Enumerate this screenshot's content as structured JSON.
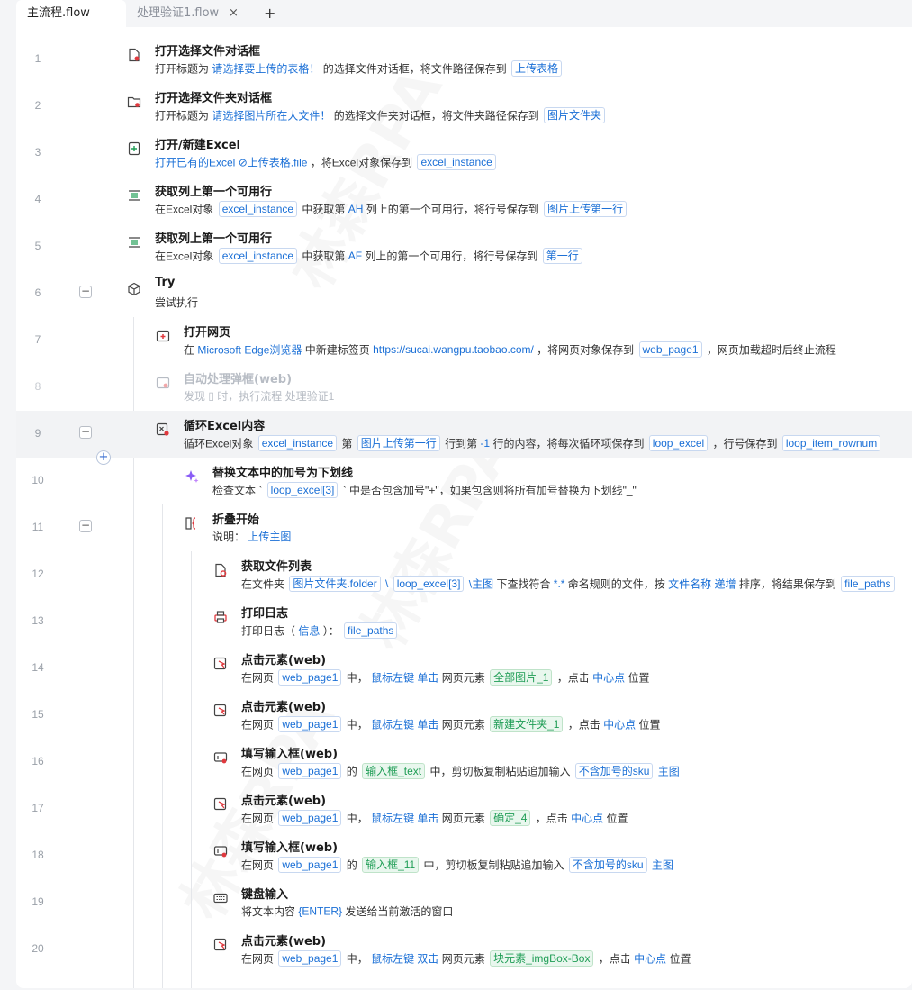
{
  "tabs": [
    {
      "label": "主流程.flow",
      "active": true
    },
    {
      "label": "处理验证1.flow",
      "active": false
    }
  ],
  "tab_close": "×",
  "tab_add": "+",
  "watermark": "林森RPA",
  "rows": [
    {
      "num": "1",
      "title": "打开选择文件对话框",
      "parts": [
        {
          "t": "打开标题为 "
        },
        {
          "t": "请选择要上传的表格！",
          "k": "lnk"
        },
        {
          "t": " 的选择文件对话框，将文件路径保存到 "
        },
        {
          "t": "上传表格",
          "k": "chip"
        }
      ]
    },
    {
      "num": "2",
      "title": "打开选择文件夹对话框",
      "parts": [
        {
          "t": "打开标题为 "
        },
        {
          "t": "请选择图片所在大文件！",
          "k": "lnk"
        },
        {
          "t": " 的选择文件夹对话框，将文件夹路径保存到 "
        },
        {
          "t": "图片文件夹",
          "k": "chip"
        }
      ]
    },
    {
      "num": "3",
      "title": "打开/新建Excel",
      "parts": [
        {
          "t": "打开已有的Excel ",
          "k": "lnk"
        },
        {
          "t": "⊘上传表格.file",
          "k": "lnk"
        },
        {
          "t": " ，将Excel对象保存到 "
        },
        {
          "t": "excel_instance",
          "k": "chip"
        }
      ]
    },
    {
      "num": "4",
      "title": "获取列上第一个可用行",
      "parts": [
        {
          "t": "在Excel对象 "
        },
        {
          "t": "excel_instance",
          "k": "chip"
        },
        {
          "t": " 中获取第 "
        },
        {
          "t": "AH",
          "k": "lnk"
        },
        {
          "t": " 列上的第一个可用行，将行号保存到 "
        },
        {
          "t": "图片上传第一行",
          "k": "chip"
        }
      ]
    },
    {
      "num": "5",
      "title": "获取列上第一个可用行",
      "parts": [
        {
          "t": "在Excel对象 "
        },
        {
          "t": "excel_instance",
          "k": "chip"
        },
        {
          "t": " 中获取第 "
        },
        {
          "t": "AF",
          "k": "lnk"
        },
        {
          "t": " 列上的第一个可用行，将行号保存到 "
        },
        {
          "t": "第一行",
          "k": "chip"
        }
      ]
    },
    {
      "num": "6",
      "title": "Try",
      "parts": [
        {
          "t": "尝试执行"
        }
      ]
    },
    {
      "num": "7",
      "title": "打开网页",
      "parts": [
        {
          "t": "在 "
        },
        {
          "t": "Microsoft Edge浏览器",
          "k": "lnk"
        },
        {
          "t": " 中新建标签页 "
        },
        {
          "t": "https://sucai.wangpu.taobao.com/",
          "k": "lnk"
        },
        {
          "t": " ，将网页对象保存到 "
        },
        {
          "t": "web_page1",
          "k": "chip"
        },
        {
          "t": " ，网页加载超时后终止流程"
        }
      ]
    },
    {
      "num": "8",
      "title": "自动处理弹框(web)",
      "parts": [
        {
          "t": "发现 "
        },
        {
          "t": "▯",
          "k": "lnk"
        },
        {
          "t": " 时，执行流程 "
        },
        {
          "t": "处理验证1",
          "k": "lnk"
        }
      ]
    },
    {
      "num": "9",
      "title": "循环Excel内容",
      "parts": [
        {
          "t": "循环Excel对象 "
        },
        {
          "t": "excel_instance",
          "k": "chip"
        },
        {
          "t": " 第 "
        },
        {
          "t": "图片上传第一行",
          "k": "chip"
        },
        {
          "t": " 行到第 "
        },
        {
          "t": "-1",
          "k": "lnk"
        },
        {
          "t": " 行的内容，将每次循环项保存到 "
        },
        {
          "t": "loop_excel",
          "k": "chip"
        },
        {
          "t": " ，行号保存到 "
        },
        {
          "t": "loop_item_rownum",
          "k": "chip"
        }
      ]
    },
    {
      "num": "10",
      "title": "替换文本中的加号为下划线",
      "parts": [
        {
          "t": "检查文本 ` "
        },
        {
          "t": "loop_excel[3]",
          "k": "chip"
        },
        {
          "t": " ` 中是否包含加号\"+\"，如果包含则将所有加号替换为下划线\"_\""
        }
      ]
    },
    {
      "num": "11",
      "title": "折叠开始",
      "parts": [
        {
          "t": "说明： "
        },
        {
          "t": "上传主图",
          "k": "lnk"
        }
      ]
    },
    {
      "num": "12",
      "title": "获取文件列表",
      "parts": [
        {
          "t": "在文件夹 "
        },
        {
          "t": "图片文件夹.folder",
          "k": "chip"
        },
        {
          "t": " \\ ",
          "k": "lnk"
        },
        {
          "t": "loop_excel[3]",
          "k": "chip"
        },
        {
          "t": " \\主图",
          "k": "lnk"
        },
        {
          "t": " 下查找符合 "
        },
        {
          "t": "*.*",
          "k": "lnk"
        },
        {
          "t": " 命名规则的文件，按 "
        },
        {
          "t": "文件名称 递增",
          "k": "lnk"
        },
        {
          "t": " 排序，将结果保存到 "
        },
        {
          "t": "file_paths",
          "k": "chip"
        }
      ]
    },
    {
      "num": "13",
      "title": "打印日志",
      "parts": [
        {
          "t": "打印日志（ "
        },
        {
          "t": "信息",
          "k": "lnk"
        },
        {
          "t": " ）： "
        },
        {
          "t": "file_paths",
          "k": "chip"
        }
      ]
    },
    {
      "num": "14",
      "title": "点击元素(web)",
      "parts": [
        {
          "t": "在网页 "
        },
        {
          "t": "web_page1",
          "k": "chip"
        },
        {
          "t": " 中， "
        },
        {
          "t": "鼠标左键 单击",
          "k": "lnk"
        },
        {
          "t": " 网页元素 "
        },
        {
          "t": "全部图片_1",
          "k": "green"
        },
        {
          "t": " ，点击 "
        },
        {
          "t": "中心点",
          "k": "lnk"
        },
        {
          "t": " 位置"
        }
      ]
    },
    {
      "num": "15",
      "title": "点击元素(web)",
      "parts": [
        {
          "t": "在网页 "
        },
        {
          "t": "web_page1",
          "k": "chip"
        },
        {
          "t": " 中， "
        },
        {
          "t": "鼠标左键 单击",
          "k": "lnk"
        },
        {
          "t": " 网页元素 "
        },
        {
          "t": "新建文件夹_1",
          "k": "green"
        },
        {
          "t": " ，点击 "
        },
        {
          "t": "中心点",
          "k": "lnk"
        },
        {
          "t": " 位置"
        }
      ]
    },
    {
      "num": "16",
      "title": "填写输入框(web)",
      "parts": [
        {
          "t": "在网页 "
        },
        {
          "t": "web_page1",
          "k": "chip"
        },
        {
          "t": " 的 "
        },
        {
          "t": "输入框_text",
          "k": "green"
        },
        {
          "t": " 中，剪切板复制粘贴追加输入 "
        },
        {
          "t": "不含加号的sku",
          "k": "chip"
        },
        {
          "t": " 主图",
          "k": "lnk"
        }
      ]
    },
    {
      "num": "17",
      "title": "点击元素(web)",
      "parts": [
        {
          "t": "在网页 "
        },
        {
          "t": "web_page1",
          "k": "chip"
        },
        {
          "t": " 中， "
        },
        {
          "t": "鼠标左键 单击",
          "k": "lnk"
        },
        {
          "t": " 网页元素 "
        },
        {
          "t": "确定_4",
          "k": "green"
        },
        {
          "t": " ，点击 "
        },
        {
          "t": "中心点",
          "k": "lnk"
        },
        {
          "t": " 位置"
        }
      ]
    },
    {
      "num": "18",
      "title": "填写输入框(web)",
      "parts": [
        {
          "t": "在网页 "
        },
        {
          "t": "web_page1",
          "k": "chip"
        },
        {
          "t": " 的 "
        },
        {
          "t": "输入框_11",
          "k": "green"
        },
        {
          "t": " 中，剪切板复制粘贴追加输入 "
        },
        {
          "t": "不含加号的sku",
          "k": "chip"
        },
        {
          "t": " 主图",
          "k": "lnk"
        }
      ]
    },
    {
      "num": "19",
      "title": "键盘输入",
      "parts": [
        {
          "t": "将文本内容 "
        },
        {
          "t": "{ENTER}",
          "k": "lnk"
        },
        {
          "t": " 发送给当前激活的窗口"
        }
      ]
    },
    {
      "num": "20",
      "title": "点击元素(web)",
      "parts": [
        {
          "t": "在网页 "
        },
        {
          "t": "web_page1",
          "k": "chip"
        },
        {
          "t": " 中， "
        },
        {
          "t": "鼠标左键 双击",
          "k": "lnk"
        },
        {
          "t": " 网页元素 "
        },
        {
          "t": "块元素_imgBox-Box",
          "k": "green"
        },
        {
          "t": " ，点击 "
        },
        {
          "t": "中心点",
          "k": "lnk"
        },
        {
          "t": " 位置"
        }
      ]
    }
  ],
  "icons": [
    "file-dialog-icon",
    "folder-dialog-icon",
    "excel-open-icon",
    "excel-row-icon",
    "excel-row-icon",
    "try-icon",
    "open-webpage-icon",
    "popup-handler-icon",
    "loop-excel-icon",
    "ai-sparkle-icon",
    "fold-start-icon",
    "file-list-icon",
    "print-log-icon",
    "click-element-icon",
    "click-element-icon",
    "fill-input-icon",
    "click-element-icon",
    "fill-input-icon",
    "keyboard-icon",
    "click-element-icon"
  ],
  "colors": {
    "link": "#1a6fd6",
    "accent_red": "#e0393e",
    "green_chip": "#1f9d55"
  }
}
